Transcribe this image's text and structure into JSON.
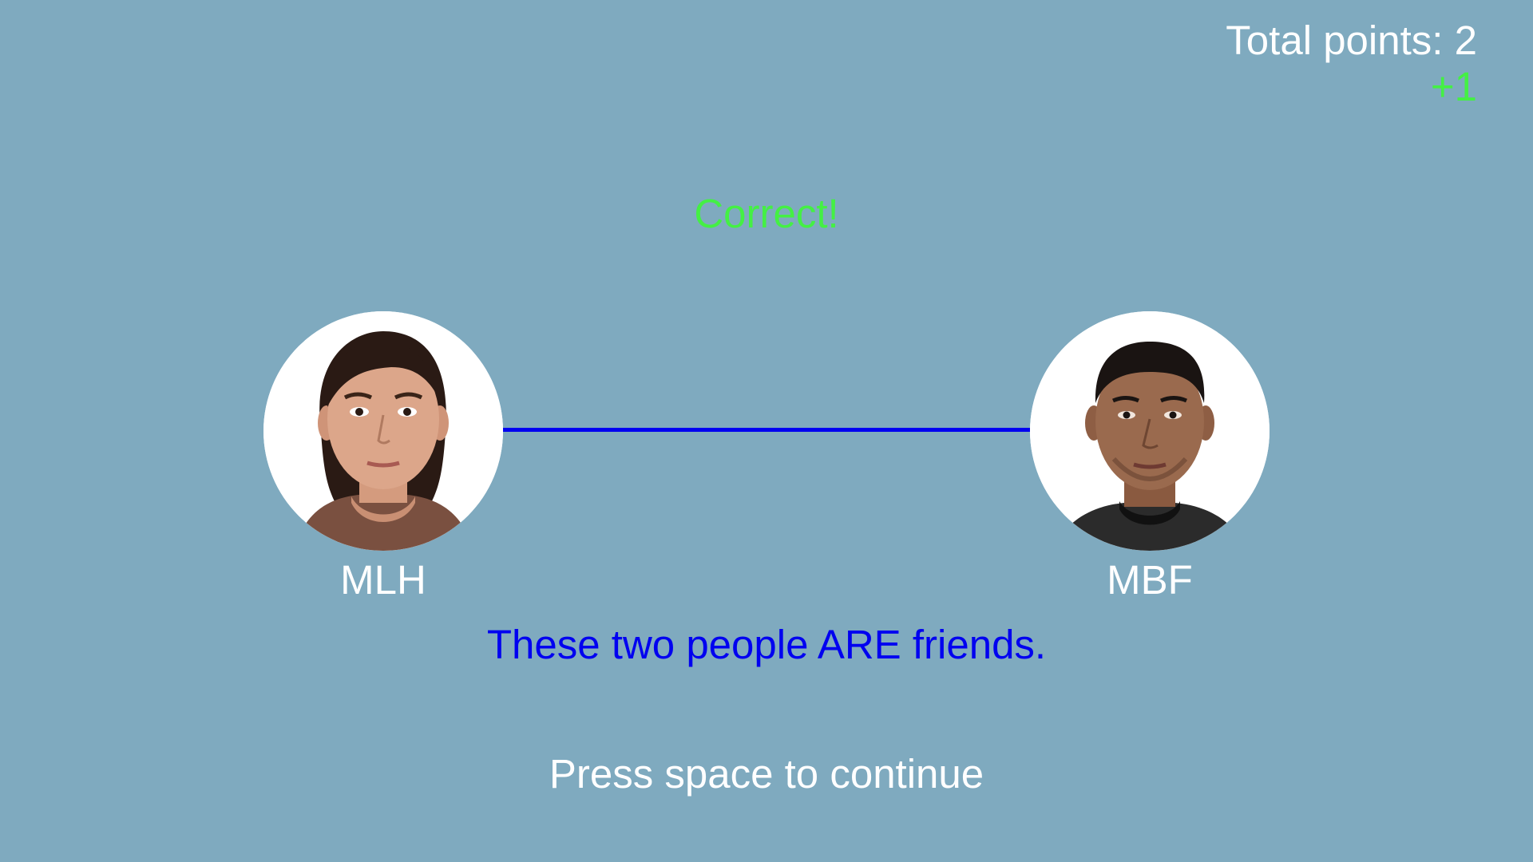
{
  "score": {
    "total_label": "Total points: 2",
    "delta_label": "+1"
  },
  "feedback": {
    "text": "Correct!"
  },
  "people": {
    "left": {
      "label": "MLH",
      "icon": "face-photo-icon"
    },
    "right": {
      "label": "MBF",
      "icon": "face-photo-icon"
    }
  },
  "verdict": {
    "text": "These two people ARE friends."
  },
  "prompt": {
    "text": "Press space to continue"
  },
  "colors": {
    "background": "#7faabf",
    "correct": "#44f044",
    "connector": "#0000f0",
    "verdict": "#0000f0",
    "text": "#ffffff"
  }
}
